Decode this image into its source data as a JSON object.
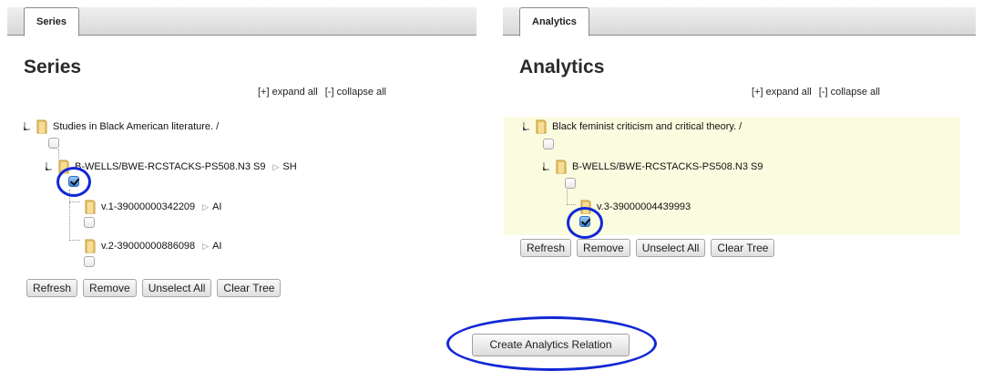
{
  "left_panel": {
    "tab_label": "Series",
    "heading": "Series",
    "expand_all": "[+] expand all",
    "collapse_all": "[-] collapse all",
    "tree": {
      "root": {
        "label": "Studies in Black American literature. /"
      },
      "holding": {
        "label": "B-WELLS/BWE-RCSTACKS-PS508.N3 S9",
        "tag": "SH",
        "checked": true
      },
      "items": [
        {
          "label": "v.1-39000000342209",
          "tag": "AI",
          "checked": false
        },
        {
          "label": "v.2-39000000886098",
          "tag": "AI",
          "checked": false
        }
      ]
    },
    "buttons": [
      "Refresh",
      "Remove",
      "Unselect All",
      "Clear Tree"
    ]
  },
  "right_panel": {
    "tab_label": "Analytics",
    "heading": "Analytics",
    "expand_all": "[+] expand all",
    "collapse_all": "[-] collapse all",
    "tree": {
      "root": {
        "label": "Black feminist criticism and critical theory. /"
      },
      "holding": {
        "label": "B-WELLS/BWE-RCSTACKS-PS508.N3 S9"
      },
      "items": [
        {
          "label": "v.3-39000004439993",
          "checked": true
        }
      ]
    },
    "buttons": [
      "Refresh",
      "Remove",
      "Unselect All",
      "Clear Tree"
    ]
  },
  "create_button": "Create Analytics Relation",
  "colors": {
    "highlight_bg": "#fbfbdf",
    "annotation_ring": "#1228d4",
    "folder": "#e8c56e"
  },
  "icons": {
    "twisty": "expanded-tree-arrow-icon",
    "folder": "folder-icon",
    "pointer": "triangle-right-icon"
  }
}
